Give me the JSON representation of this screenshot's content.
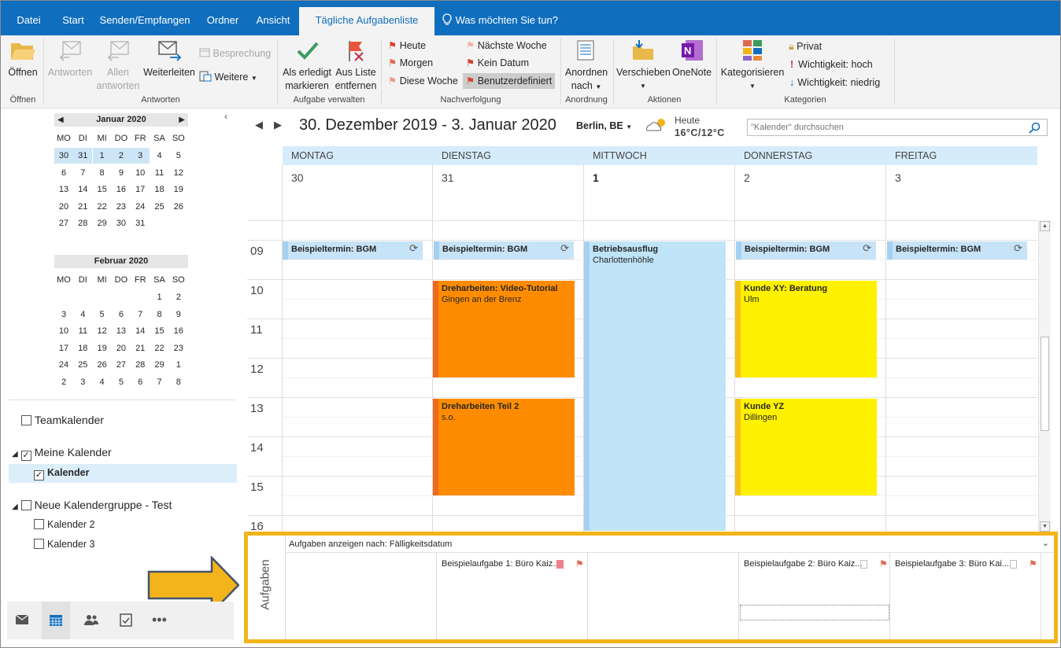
{
  "tabs": [
    "Datei",
    "Start",
    "Senden/Empfangen",
    "Ordner",
    "Ansicht",
    "Tägliche Aufgabenliste",
    "Was möchten Sie tun?"
  ],
  "ribbon": {
    "oeffnen": "Öffnen",
    "antworten": "Antworten",
    "allen": "Allen",
    "antworten2": "antworten",
    "weiterleiten": "Weiterleiten",
    "besprechung": "Besprechung",
    "weitere": "Weitere",
    "grp_oeffnen": "Öffnen",
    "grp_antworten": "Antworten",
    "als_erledigt": "Als erledigt",
    "markieren": "markieren",
    "aus_liste": "Aus Liste",
    "entfernen": "entfernen",
    "grp_aufgabe": "Aufgabe verwalten",
    "heute": "Heute",
    "morgen": "Morgen",
    "diese_woche": "Diese Woche",
    "naechste_woche": "Nächste Woche",
    "kein_datum": "Kein Datum",
    "benutzerdefiniert": "Benutzerdefiniert",
    "grp_nachverfolgung": "Nachverfolgung",
    "anordnen": "Anordnen",
    "nach": "nach",
    "grp_anordnung": "Anordnung",
    "verschieben": "Verschieben",
    "onenote": "OneNote",
    "grp_aktionen": "Aktionen",
    "kategorisieren": "Kategorisieren",
    "privat": "Privat",
    "wichtig_hoch": "Wichtigkeit: hoch",
    "wichtig_niedrig": "Wichtigkeit: niedrig",
    "grp_kategorien": "Kategorien"
  },
  "colors": {
    "accent": "#106ebe",
    "ribbon_bg": "#f3f3f3",
    "day_header": "#d6ecfb",
    "orange": "#ff8c00",
    "yellow": "#fff100",
    "lightblue": "#c0e4f7",
    "highlight": "#f3b41b"
  },
  "mini": {
    "jan_title": "Januar 2020",
    "feb_title": "Februar 2020",
    "weekdays": [
      "MO",
      "DI",
      "MI",
      "DO",
      "FR",
      "SA",
      "SO"
    ],
    "jan": [
      [
        "30",
        "31",
        "1",
        "2",
        "3",
        "4",
        "5"
      ],
      [
        "6",
        "7",
        "8",
        "9",
        "10",
        "11",
        "12"
      ],
      [
        "13",
        "14",
        "15",
        "16",
        "17",
        "18",
        "19"
      ],
      [
        "20",
        "21",
        "22",
        "23",
        "24",
        "25",
        "26"
      ],
      [
        "27",
        "28",
        "29",
        "30",
        "31",
        "",
        ""
      ]
    ],
    "feb": [
      [
        "",
        "",
        "",
        "",
        "",
        "1",
        "2"
      ],
      [
        "3",
        "4",
        "5",
        "6",
        "7",
        "8",
        "9"
      ],
      [
        "10",
        "11",
        "12",
        "13",
        "14",
        "15",
        "16"
      ],
      [
        "17",
        "18",
        "19",
        "20",
        "21",
        "22",
        "23"
      ],
      [
        "24",
        "25",
        "26",
        "27",
        "28",
        "29",
        "1"
      ],
      [
        "2",
        "3",
        "4",
        "5",
        "6",
        "7",
        "8"
      ]
    ]
  },
  "folders": {
    "teamkalender": "Teamkalender",
    "meine": "Meine Kalender",
    "kalender": "Kalender",
    "neue": "Neue Kalendergruppe - Test",
    "kalender2": "Kalender 2",
    "kalender3": "Kalender 3"
  },
  "calendar": {
    "range": "30. Dezember 2019 - 3. Januar 2020",
    "location": "Berlin, BE",
    "weather_label": "Heute",
    "weather_temp": "16°C/12°C",
    "search_placeholder": "\"Kalender\" durchsuchen",
    "days": [
      {
        "name": "MONTAG",
        "num": "30"
      },
      {
        "name": "DIENSTAG",
        "num": "31"
      },
      {
        "name": "MITTWOCH",
        "num": "1"
      },
      {
        "name": "DONNERSTAG",
        "num": "2"
      },
      {
        "name": "FREITAG",
        "num": "3"
      }
    ],
    "hours": [
      "09",
      "10",
      "11",
      "12",
      "13",
      "14",
      "15",
      "16"
    ],
    "events": {
      "bgm": "Beispieltermin: BGM",
      "dreh1_title": "Dreharbeiten: Video-Tutorial",
      "dreh1_loc": "Gingen an der Brenz",
      "dreh2_title": "Dreharbeiten Teil 2",
      "dreh2_loc": "s.o.",
      "ausflug_title": "Betriebsausflug",
      "ausflug_loc": "Charlottenhöhle",
      "xy_title": "Kunde XY: Beratung",
      "xy_loc": "Ulm",
      "yz_title": "Kunde YZ",
      "yz_loc": "Dillingen"
    }
  },
  "tasks": {
    "label": "Aufgaben",
    "sort": "Aufgaben anzeigen nach: Fälligkeitsdatum",
    "t1": "Beispielaufgabe 1: Büro Kaiz...",
    "t2": "Beispielaufgabe 2: Büro Kaiz...",
    "t3": "Beispielaufgabe 3: Büro Kai..."
  }
}
